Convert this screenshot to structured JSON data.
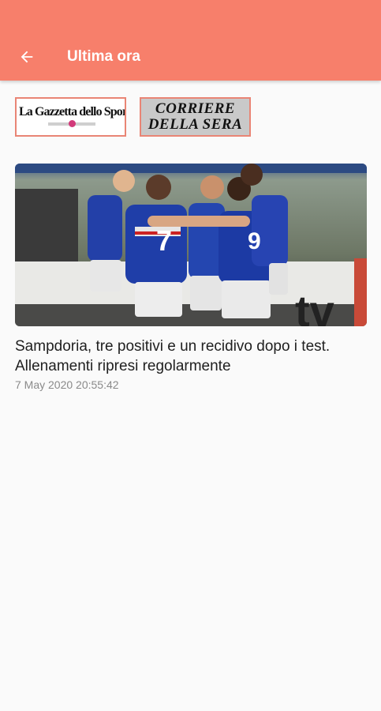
{
  "appbar": {
    "title": "Ultima ora",
    "back_icon": "arrow-left-icon",
    "color": "#f77f6b"
  },
  "sources": [
    {
      "name": "La Gazzetta dello Sport"
    },
    {
      "line1": "CORRIERE",
      "line2": "DELLA SERA"
    }
  ],
  "article": {
    "title": "Sampdoria, tre positivi e un recidivo dopo i test. Allenamenti ripresi regolarmente",
    "date": "7 May 2020 20:55:42",
    "image": {
      "jersey_numbers": [
        "7",
        "9"
      ]
    }
  }
}
